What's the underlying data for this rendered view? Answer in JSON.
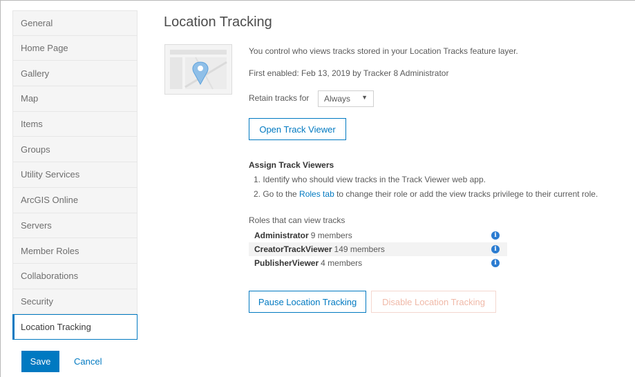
{
  "sidebar": {
    "items": [
      {
        "label": "General"
      },
      {
        "label": "Home Page"
      },
      {
        "label": "Gallery"
      },
      {
        "label": "Map"
      },
      {
        "label": "Items"
      },
      {
        "label": "Groups"
      },
      {
        "label": "Utility Services"
      },
      {
        "label": "ArcGIS Online"
      },
      {
        "label": "Servers"
      },
      {
        "label": "Member Roles"
      },
      {
        "label": "Collaborations"
      },
      {
        "label": "Security"
      },
      {
        "label": "Location Tracking"
      }
    ],
    "active_index": 12
  },
  "footer": {
    "save_label": "Save",
    "cancel_label": "Cancel"
  },
  "main": {
    "title": "Location Tracking",
    "intro": "You control who views tracks stored in your Location Tracks feature layer.",
    "first_enabled": "First enabled: Feb 13, 2019 by Tracker 8 Administrator",
    "retain_label": "Retain tracks for",
    "retain_value": "Always",
    "open_viewer_label": "Open Track Viewer",
    "assign_heading": "Assign Track Viewers",
    "step1": "1. Identify who should view tracks in the Track Viewer web app.",
    "step2_prefix": "2. Go to the ",
    "step2_link": "Roles tab",
    "step2_suffix": " to change their role or add the view tracks privilege to their current role.",
    "roles_heading": "Roles that can view tracks",
    "roles": [
      {
        "name": "Administrator",
        "members": "9 members"
      },
      {
        "name": "CreatorTrackViewer",
        "members": "149 members"
      },
      {
        "name": "PublisherViewer",
        "members": "4 members"
      }
    ],
    "pause_label": "Pause Location Tracking",
    "disable_label": "Disable Location Tracking"
  },
  "colors": {
    "accent": "#0079c1",
    "disabled": "#f0b9a8",
    "info": "#2b7cd1"
  }
}
